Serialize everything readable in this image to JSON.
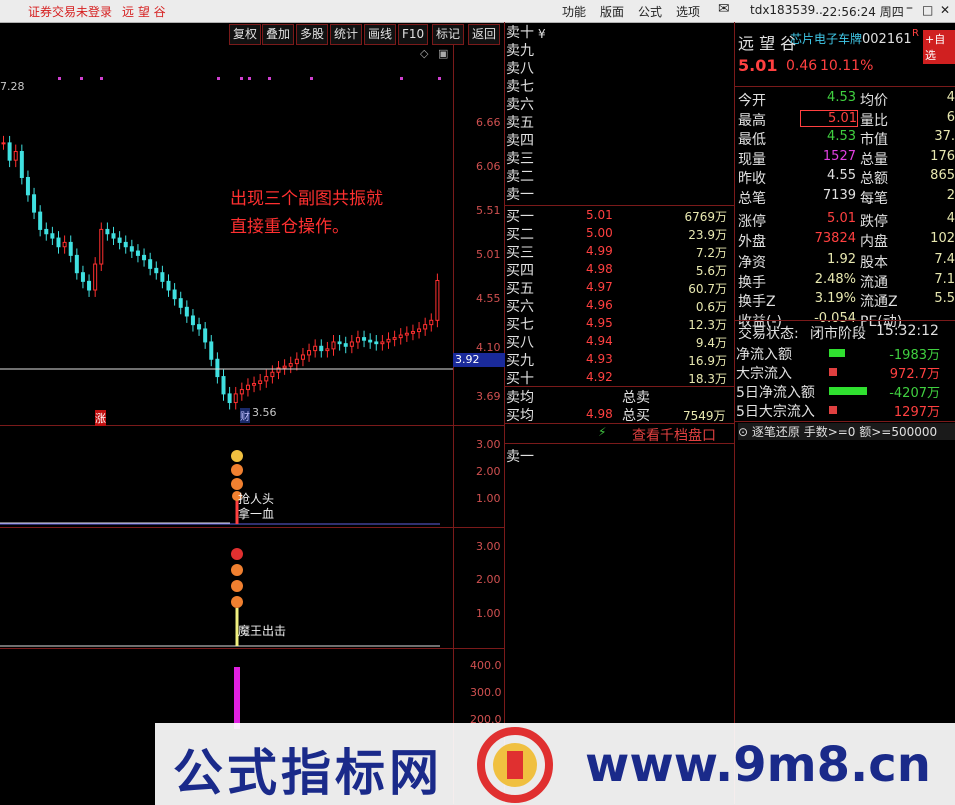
{
  "titlebar": {
    "login_status": "证券交易未登录",
    "stock_name": "远 望 谷",
    "menu": [
      "功能",
      "版面",
      "公式",
      "选项"
    ],
    "account": "tdx183539...",
    "time": "22:56:24 周四"
  },
  "chart_toolbar": [
    "复权",
    "叠加",
    "多股",
    "统计",
    "画线",
    "F10",
    "标记",
    "返回"
  ],
  "main_chart": {
    "high_label": "7.28",
    "low_label": "3.56",
    "price_ticks": [
      "6.66",
      "6.06",
      "5.51",
      "5.01",
      "4.55",
      "4.10",
      "3.69"
    ],
    "current_price_tag": "3.92",
    "annotation_line1": "出现三个副图共振就",
    "annotation_line2": "直接重仓操作。",
    "marker_zhang": "涨",
    "marker_cai": "财"
  },
  "sub1": {
    "ticks": [
      "3.00",
      "2.00",
      "1.00"
    ],
    "label1": "抢人头",
    "label2": "拿一血"
  },
  "sub2": {
    "ticks": [
      "3.00",
      "2.00",
      "1.00"
    ],
    "label": "魔王出击"
  },
  "sub3": {
    "ticks": [
      "400.0",
      "300.0",
      "200.0"
    ]
  },
  "order_book": {
    "sell_labels": [
      "卖十",
      "卖九",
      "卖八",
      "卖七",
      "卖六",
      "卖五",
      "卖四",
      "卖三",
      "卖二",
      "卖一"
    ],
    "sell_extra": "¥",
    "buys": [
      {
        "label": "买一",
        "price": "5.01",
        "vol": "6769万"
      },
      {
        "label": "买二",
        "price": "5.00",
        "vol": "23.9万"
      },
      {
        "label": "买三",
        "price": "4.99",
        "vol": "7.2万"
      },
      {
        "label": "买四",
        "price": "4.98",
        "vol": "5.6万"
      },
      {
        "label": "买五",
        "price": "4.97",
        "vol": "60.7万"
      },
      {
        "label": "买六",
        "price": "4.96",
        "vol": "0.6万"
      },
      {
        "label": "买七",
        "price": "4.95",
        "vol": "12.3万"
      },
      {
        "label": "买八",
        "price": "4.94",
        "vol": "9.4万"
      },
      {
        "label": "买九",
        "price": "4.93",
        "vol": "16.9万"
      },
      {
        "label": "买十",
        "price": "4.92",
        "vol": "18.3万"
      }
    ],
    "sell_avg_label": "卖均",
    "sell_total_label": "总卖",
    "buy_avg_label": "买均",
    "buy_avg": "4.98",
    "buy_total_label": "总买",
    "buy_total": "7549万",
    "depth_link": "查看千档盘口",
    "tick_sell1": "卖一"
  },
  "quote": {
    "name": "远 望 谷",
    "sector": "芯片电子车牌",
    "code": "002161",
    "tag": "R",
    "add_btn": "+自选",
    "price": "5.01",
    "change": "0.46",
    "pct": "10.11%",
    "rows": [
      {
        "l1": "今开",
        "v1": "4.53",
        "c1": "green",
        "l2": "均价",
        "v2": "4"
      },
      {
        "l1": "最高",
        "v1": "5.01",
        "c1": "red",
        "l2": "量比",
        "v2": "6"
      },
      {
        "l1": "最低",
        "v1": "4.53",
        "c1": "green",
        "l2": "市值",
        "v2": "37."
      },
      {
        "l1": "现量",
        "v1": "1527",
        "c1": "magenta",
        "l2": "总量",
        "v2": "176"
      },
      {
        "l1": "昨收",
        "v1": "4.55",
        "c1": "white",
        "l2": "总额",
        "v2": "865"
      },
      {
        "l1": "总笔",
        "v1": "7139",
        "c1": "white",
        "l2": "每笔",
        "v2": "2"
      },
      {
        "l1": "涨停",
        "v1": "5.01",
        "c1": "red",
        "l2": "跌停",
        "v2": "4"
      },
      {
        "l1": "外盘",
        "v1": "73824",
        "c1": "red",
        "l2": "内盘",
        "v2": "102"
      },
      {
        "l1": "净资",
        "v1": "1.92",
        "c1": "yellow",
        "l2": "股本",
        "v2": "7.4"
      },
      {
        "l1": "换手",
        "v1": "2.48%",
        "c1": "yellow",
        "l2": "流通",
        "v2": "7.1"
      },
      {
        "l1": "换手Z",
        "v1": "3.19%",
        "c1": "yellow",
        "l2": "流通Z",
        "v2": "5.5"
      },
      {
        "l1": "收益(-)",
        "v1": "-0.054",
        "c1": "yellow",
        "l2": "PE(动)",
        "v2": ""
      }
    ],
    "trade_status_label": "交易状态:",
    "trade_status": "闭市阶段",
    "trade_time": "15:32:12",
    "flows": [
      {
        "label": "净流入额",
        "value": "-1983万",
        "extra": "-",
        "color": "green"
      },
      {
        "label": "大宗流入",
        "value": "972.7万",
        "extra": "",
        "color": "red"
      },
      {
        "label": "5日净流入额",
        "value": "-4207万",
        "extra": "",
        "color": "green"
      },
      {
        "label": "5日大宗流入",
        "value": "1297万",
        "extra": "",
        "color": "red"
      }
    ],
    "tick_filter": "逐笔还原 手数>=0 额>=500000"
  },
  "watermark": {
    "text": "公式指标网",
    "url": "www.9m8.cn"
  }
}
